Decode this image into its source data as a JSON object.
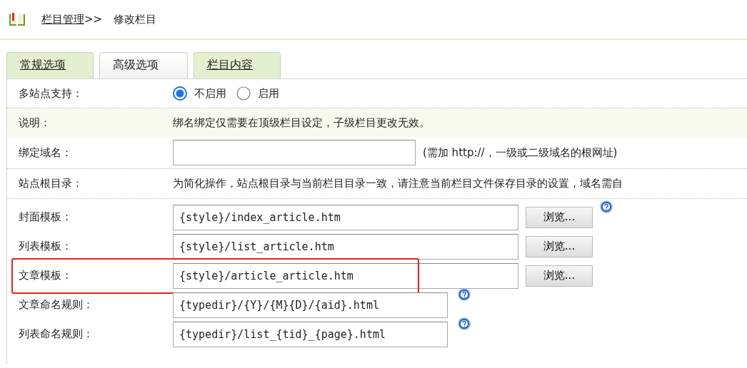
{
  "breadcrumb": {
    "link": "栏目管理",
    "separator": ">>",
    "current": "修改栏目"
  },
  "tabs": [
    {
      "label": "常规选项",
      "selected": false
    },
    {
      "label": "高级选项",
      "selected": true
    },
    {
      "label": "栏目内容",
      "selected": false
    }
  ],
  "rows": [
    {
      "kind": "radio",
      "label": "多站点支持：",
      "options": [
        {
          "label": "不启用",
          "selected": true
        },
        {
          "label": "启用",
          "selected": false
        }
      ]
    },
    {
      "kind": "note",
      "label": "说明：",
      "text": "绑名绑定仅需要在顶级栏目设定，子级栏目更改无效。"
    },
    {
      "kind": "field",
      "label": "绑定域名：",
      "value": "",
      "hint": "(需加 http://，一级或二级域名的根网址)"
    },
    {
      "kind": "text",
      "label": "站点根目录：",
      "text": "为简化操作，站点根目录与当前栏目目录一致，请注意当前栏目文件保存目录的设置，域名需自"
    },
    {
      "kind": "template",
      "label": "封面模板：",
      "value": "{style}/index_article.htm",
      "button": "浏览...",
      "help": true,
      "highlighted": false
    },
    {
      "kind": "template",
      "label": "列表模板：",
      "value": "{style}/list_article.htm",
      "button": "浏览...",
      "help": false,
      "highlighted": false
    },
    {
      "kind": "template",
      "label": "文章模板：",
      "value": "{style}/article_article.htm",
      "button": "浏览...",
      "help": false,
      "highlighted": true
    },
    {
      "kind": "rule",
      "label": "文章命名规则：",
      "value": "{typedir}/{Y}/{M}{D}/{aid}.html",
      "help": true
    },
    {
      "kind": "rule",
      "label": "列表命名规则：",
      "value": "{typedir}/list_{tid}_{page}.html",
      "help": true
    }
  ]
}
